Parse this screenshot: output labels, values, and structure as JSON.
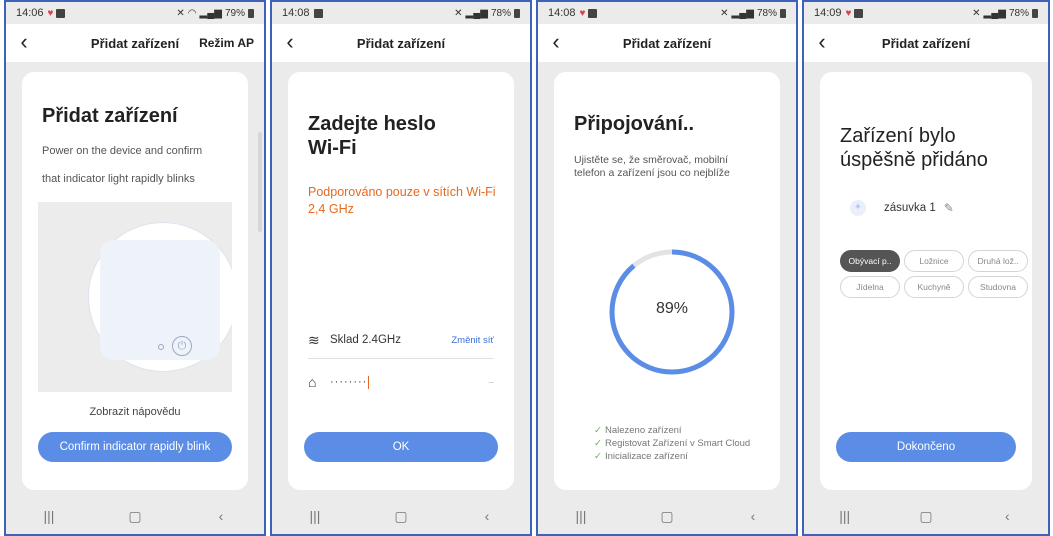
{
  "phones": [
    {
      "status": {
        "time": "14:06",
        "battery": "79%"
      },
      "nav": {
        "title": "Přidat zařízení",
        "right": "Režim AP"
      },
      "heading": "Přidat zařízení",
      "line1": "Power on the device and confirm",
      "line2": "that indicator light rapidly blinks",
      "help_link": "Zobrazit nápovědu",
      "button": "Confirm indicator rapidly blink"
    },
    {
      "status": {
        "time": "14:08",
        "battery": "78%"
      },
      "nav": {
        "title": "Přidat zařízení"
      },
      "heading_line1": "Zadejte heslo",
      "heading_line2": "Wi-Fi",
      "warning": "Podporováno pouze v sítích Wi-Fi 2,4 GHz",
      "wifi_name": "Sklad 2.4GHz",
      "change_link": "Změnit síť",
      "password_mask": "········",
      "button": "OK"
    },
    {
      "status": {
        "time": "14:08",
        "battery": "78%"
      },
      "nav": {
        "title": "Přidat zařízení"
      },
      "heading": "Připojování..",
      "info": "Ujistěte se, že směrovač, mobilní telefon a zařízení jsou co nejblíže",
      "progress_label": "89%",
      "progress_fraction": 0.89,
      "steps": [
        "Nalezeno zařízení",
        "Registovat Zařízení v Smart Cloud",
        "Inicializace zařízení"
      ]
    },
    {
      "status": {
        "time": "14:09",
        "battery": "78%"
      },
      "nav": {
        "title": "Přidat zařízení"
      },
      "heading_line1": "Zařízení bylo",
      "heading_line2": "úspěšně přidáno",
      "device_name": "zásuvka 1",
      "rooms": [
        "Obývací p..",
        "Ložnice",
        "Druhá lož..",
        "Jídelna",
        "Kuchyně",
        "Studovna"
      ],
      "selected_room": "Obývací p..",
      "button": "Dokončeno"
    }
  ],
  "colors": {
    "accent": "#5b8de6",
    "warning": "#e46a1f",
    "frame": "#3d63b8",
    "check": "#68b55a"
  }
}
